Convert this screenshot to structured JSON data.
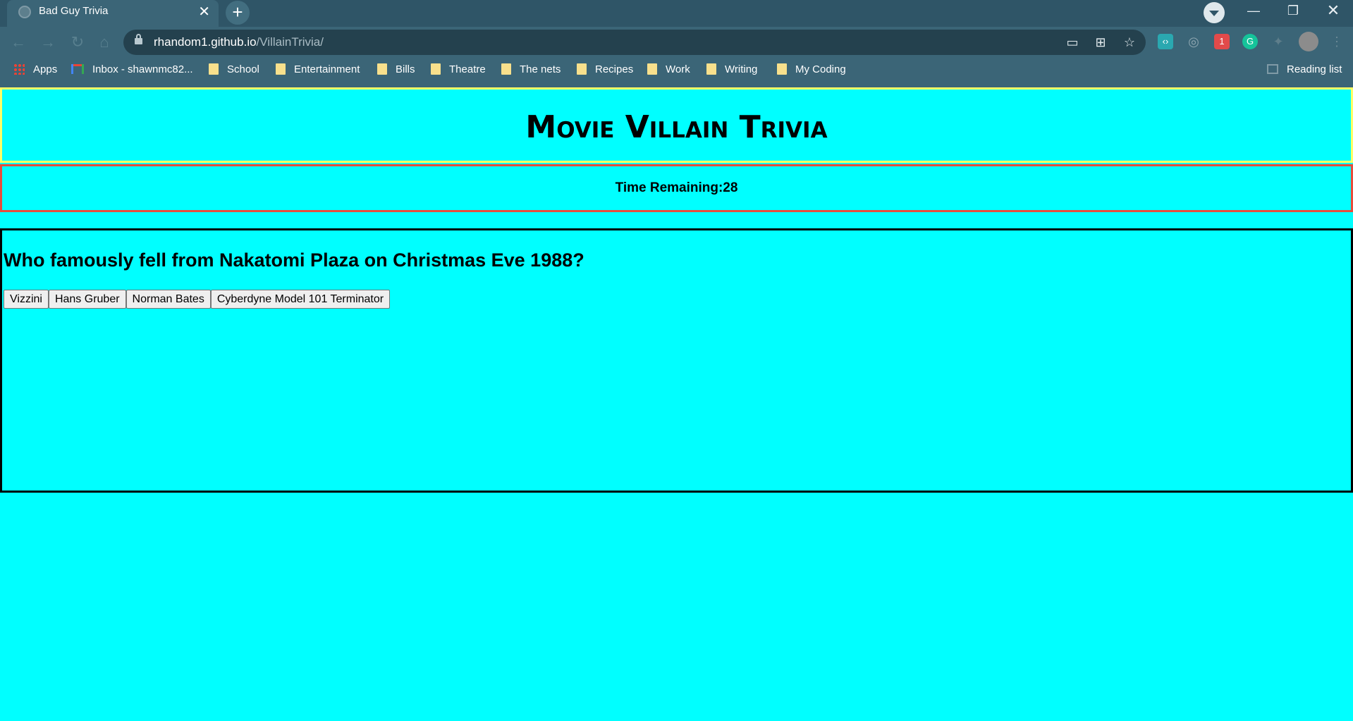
{
  "browser": {
    "tab_title": "Bad Guy Trivia",
    "tab_close": "✕",
    "new_tab": "+",
    "url_host": "rhandom1.github.io",
    "url_path": "/VillainTrivia/",
    "bookmarks": [
      {
        "label": "Apps",
        "icon": "apps-grid-icon"
      },
      {
        "label": "Inbox - shawnmc82...",
        "icon": "gmail-icon"
      },
      {
        "label": "School",
        "icon": "folder-icon"
      },
      {
        "label": "Entertainment",
        "icon": "folder-icon"
      },
      {
        "label": "Bills",
        "icon": "folder-icon"
      },
      {
        "label": "Theatre",
        "icon": "folder-icon"
      },
      {
        "label": "The nets",
        "icon": "folder-icon"
      },
      {
        "label": "Recipes",
        "icon": "folder-icon"
      },
      {
        "label": "Work",
        "icon": "folder-icon"
      },
      {
        "label": "Writing",
        "icon": "folder-icon"
      },
      {
        "label": "My Coding",
        "icon": "folder-icon"
      }
    ],
    "reading_list": "Reading list"
  },
  "page": {
    "title": "Movie Villain Trivia",
    "timer_label": "Time Remaining:28",
    "question": "Who famously fell from Nakatomi Plaza on Christmas Eve 1988?",
    "answers": [
      "Vizzini",
      "Hans Gruber",
      "Norman Bates",
      "Cyberdyne Model 101 Terminator"
    ]
  },
  "colors": {
    "page_background": "#00ffff",
    "header_border": "#ffff66",
    "timer_border": "#e74c3c",
    "question_border": "#000000",
    "chrome_background": "#3b6577"
  }
}
